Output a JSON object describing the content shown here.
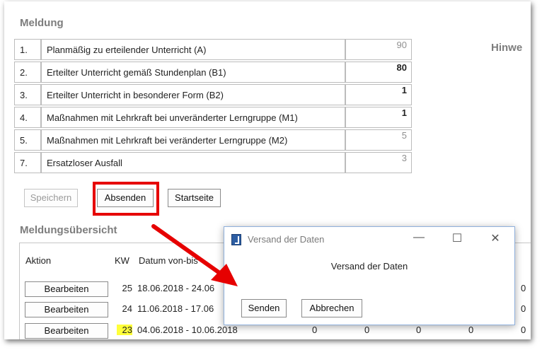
{
  "meldung": {
    "title": "Meldung",
    "hinweis": "Hinwe",
    "rows": [
      {
        "num": "1.",
        "label": "Planmäßig zu erteilender Unterricht (A)",
        "value": "90"
      },
      {
        "num": "2.",
        "label": "Erteilter Unterricht gemäß Stundenplan (B1)",
        "value": "80"
      },
      {
        "num": "3.",
        "label": "Erteilter Unterricht in besonderer Form (B2)",
        "value": "1"
      },
      {
        "num": "4.",
        "label": "Maßnahmen mit Lehrkraft bei unveränderter Lerngruppe (M1)",
        "value": "1"
      },
      {
        "num": "5.",
        "label": "Maßnahmen mit Lehrkraft bei veränderter Lerngruppe (M2)",
        "value": "5"
      },
      {
        "num": "7.",
        "label": "Ersatzloser Ausfall",
        "value": "3"
      }
    ]
  },
  "buttons": {
    "save": "Speichern",
    "send": "Absenden",
    "home": "Startseite"
  },
  "overview": {
    "title": "Meldungsübersicht",
    "headers": {
      "action": "Aktion",
      "kw": "KW",
      "date": "Datum von-bis"
    },
    "rows": [
      {
        "action": "Bearbeiten",
        "kw": "25",
        "date": "18.06.2018 - 24.06",
        "end_value": "0"
      },
      {
        "action": "Bearbeiten",
        "kw": "24",
        "date": "11.06.2018 - 17.06",
        "end_value": "0"
      },
      {
        "action": "Bearbeiten",
        "kw": "23",
        "date": "04.06.2018 - 10.06.2018",
        "vals": [
          "0",
          "0",
          "0",
          "0",
          "0"
        ]
      }
    ]
  },
  "dialog": {
    "title": "Versand der Daten",
    "message": "Versand der Daten",
    "send": "Senden",
    "cancel": "Abbrechen",
    "minimize": "—",
    "maximize": "☐",
    "close": "✕"
  },
  "colors": {
    "highlight": "#e60000",
    "arrow": "#e60000",
    "kw_highlight": "#ffff3a"
  }
}
